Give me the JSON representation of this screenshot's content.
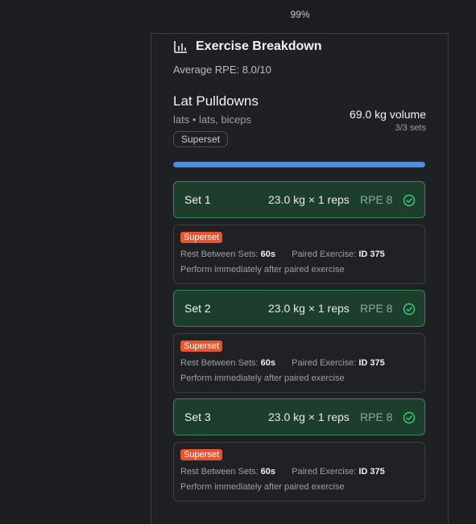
{
  "zoom": "99%",
  "header": {
    "title": "Exercise Breakdown",
    "icon": "bar-chart-icon"
  },
  "average_rpe": "Average RPE: 8.0/10",
  "exercise": {
    "name": "Lat Pulldowns",
    "muscles": "lats • lats, biceps",
    "tag": "Superset",
    "volume": "69.0 kg volume",
    "sets_done": "3/3 sets",
    "progress_percent": 100
  },
  "sets": [
    {
      "label": "Set 1",
      "weight": "23.0 kg × 1 reps",
      "rpe": "RPE 8"
    },
    {
      "label": "Set 2",
      "weight": "23.0 kg × 1 reps",
      "rpe": "RPE 8"
    },
    {
      "label": "Set 3",
      "weight": "23.0 kg × 1 reps",
      "rpe": "RPE 8"
    }
  ],
  "notes": [
    {
      "badge": "Superset",
      "rest_label": "Rest Between Sets:",
      "rest_value": "60s",
      "paired_label": "Paired Exercise:",
      "paired_value": "ID 375",
      "instruction": "Perform immediately after paired exercise"
    },
    {
      "badge": "Superset",
      "rest_label": "Rest Between Sets:",
      "rest_value": "60s",
      "paired_label": "Paired Exercise:",
      "paired_value": "ID 375",
      "instruction": "Perform immediately after paired exercise"
    },
    {
      "badge": "Superset",
      "rest_label": "Rest Between Sets:",
      "rest_value": "60s",
      "paired_label": "Paired Exercise:",
      "paired_value": "ID 375",
      "instruction": "Perform immediately after paired exercise"
    }
  ],
  "colors": {
    "accent_blue": "#4a8fe7",
    "set_complete_bg": "#1d3e2c",
    "set_complete_border": "#2f8a55",
    "check_green": "#3ecf7a",
    "superset_badge": "#e8542c"
  }
}
